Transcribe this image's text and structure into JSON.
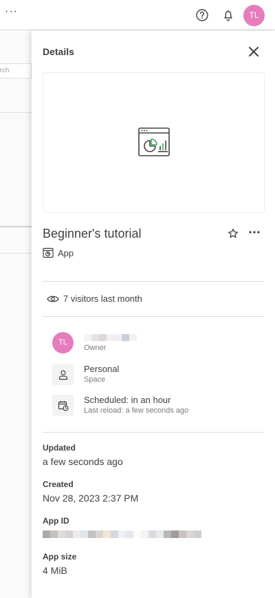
{
  "topbar": {
    "more_label": "···",
    "help_icon": "help-circle-icon",
    "bell_icon": "bell-icon",
    "avatar_initials": "TL"
  },
  "background_page": {
    "search_placeholder": "arch"
  },
  "panel": {
    "title": "Details",
    "app_name": "Beginner's tutorial",
    "type_label": "App",
    "visitors_label": "7 visitors last month",
    "owner": {
      "initials": "TL",
      "role_label": "Owner"
    },
    "space": {
      "name": "Personal",
      "role_label": "Space"
    },
    "reload": {
      "status": "Scheduled: in an hour",
      "last_reload": "Last reload: a few seconds ago"
    },
    "fields": {
      "updated_label": "Updated",
      "updated_value": "a few seconds ago",
      "created_label": "Created",
      "created_value": "Nov 28, 2023 2:37 PM",
      "app_id_label": "App ID",
      "app_size_label": "App size",
      "app_size_value": "4 MiB"
    }
  },
  "colors": {
    "avatar": "#e67cbd",
    "text": "#404040",
    "muted": "#7a7a7a",
    "chart_green": "#3bab5a"
  }
}
